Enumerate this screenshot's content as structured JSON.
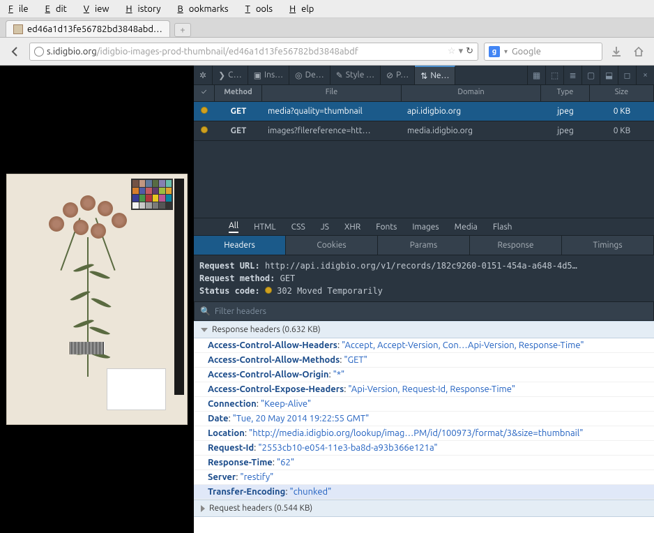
{
  "menu": {
    "file": "File",
    "edit": "Edit",
    "view": "View",
    "history": "History",
    "bookmarks": "Bookmarks",
    "tools": "Tools",
    "help": "Help"
  },
  "tab": {
    "title": "ed46a1d13fe56782bd3848abd…"
  },
  "url": {
    "host": "s.idigbio.org",
    "path": "/idigbio-images-prod-thumbnail/ed46a1d13fe56782bd3848abdf"
  },
  "search": {
    "placeholder": "Google"
  },
  "devtools": {
    "tools": {
      "console": "C…",
      "inspect": "Ins…",
      "debug": "De…",
      "style": "Style …",
      "prof": "P…",
      "net": "Ne…"
    },
    "net": {
      "cols": {
        "chk": "✓",
        "method": "Method",
        "file": "File",
        "domain": "Domain",
        "type": "Type",
        "size": "Size"
      },
      "rows": [
        {
          "method": "GET",
          "file": "media?quality=thumbnail",
          "domain": "api.idigbio.org",
          "type": "jpeg",
          "size": "0 KB"
        },
        {
          "method": "GET",
          "file": "images?filereference=htt…",
          "domain": "media.idigbio.org",
          "type": "jpeg",
          "size": "0 KB"
        }
      ],
      "filters": {
        "all": "All",
        "html": "HTML",
        "css": "CSS",
        "js": "JS",
        "xhr": "XHR",
        "fonts": "Fonts",
        "images": "Images",
        "media": "Media",
        "flash": "Flash"
      },
      "detailtabs": {
        "headers": "Headers",
        "cookies": "Cookies",
        "params": "Params",
        "response": "Response",
        "timings": "Timings"
      },
      "summary": {
        "url_label": "Request URL:",
        "url": "http://api.idigbio.org/v1/records/182c9260-0151-454a-a648-4d5…",
        "method_label": "Request method:",
        "method": "GET",
        "status_label": "Status code:",
        "status": "302 Moved Temporarily"
      },
      "filter_placeholder": "Filter headers",
      "response_headers_title": "Response headers (0.632 KB)",
      "request_headers_title": "Request headers (0.544 KB)",
      "headers": [
        {
          "name": "Access-Control-Allow-Headers",
          "value": "\"Accept, Accept-Version, Con…Api-Version, Response-Time\""
        },
        {
          "name": "Access-Control-Allow-Methods",
          "value": "\"GET\""
        },
        {
          "name": "Access-Control-Allow-Origin",
          "value": "\"*\""
        },
        {
          "name": "Access-Control-Expose-Headers",
          "value": "\"Api-Version, Request-Id, Response-Time\""
        },
        {
          "name": "Connection",
          "value": "\"Keep-Alive\""
        },
        {
          "name": "Date",
          "value": "\"Tue, 20 May 2014 19:22:55 GMT\""
        },
        {
          "name": "Location",
          "value": "\"http://media.idigbio.org/lookup/imag…PM/id/100973/format/3&size=thumbnail\""
        },
        {
          "name": "Request-Id",
          "value": "\"2553cb10-e054-11e3-ba8d-a93b366e121a\""
        },
        {
          "name": "Response-Time",
          "value": "\"62\""
        },
        {
          "name": "Server",
          "value": "\"restify\""
        },
        {
          "name": "Transfer-Encoding",
          "value": "\"chunked\""
        }
      ]
    }
  }
}
